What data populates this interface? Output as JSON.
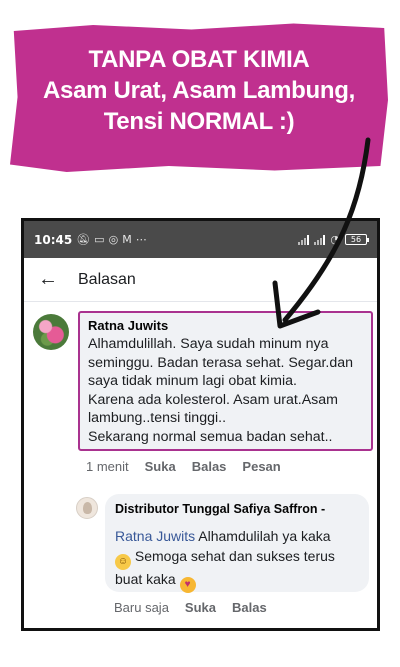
{
  "banner": {
    "line1": "TANPA OBAT KIMIA",
    "line2": "Asam Urat, Asam Lambung,",
    "line3": "Tensi NORMAL :)",
    "color": "#c0308f"
  },
  "statusbar": {
    "time": "10:45",
    "icons_left": [
      "mute-icon",
      "message-icon",
      "instagram-icon",
      "gmail-icon",
      "more-icon"
    ],
    "icons_right": [
      "signal-icon",
      "signal-icon",
      "wifi-icon",
      "battery-icon"
    ],
    "battery": "56"
  },
  "appbar": {
    "title": "Balasan"
  },
  "comment": {
    "author": "Ratna Juwits",
    "text": "Alhamdulillah. Saya sudah minum nya\nseminggu. Badan terasa sehat. Segar.dan\nsaya tidak minum lagi obat kimia.\nKarena ada kolesterol. Asam urat.Asam\nlambung..tensi tinggi..\nSekarang normal semua badan sehat..",
    "highlight_color": "#a9328f",
    "time": "1 menit",
    "actions": [
      "Suka",
      "Balas",
      "Pesan"
    ]
  },
  "reply": {
    "author": "Distributor Tunggal Safiya Saffron -",
    "mention": "Ratna Juwits",
    "text_part1": " Alhamdulilah ya kaka",
    "text_part2": " Semoga sehat dan sukses terus",
    "text_part3": "buat kaka ",
    "time": "Baru saja",
    "actions": [
      "Suka",
      "Balas"
    ]
  }
}
